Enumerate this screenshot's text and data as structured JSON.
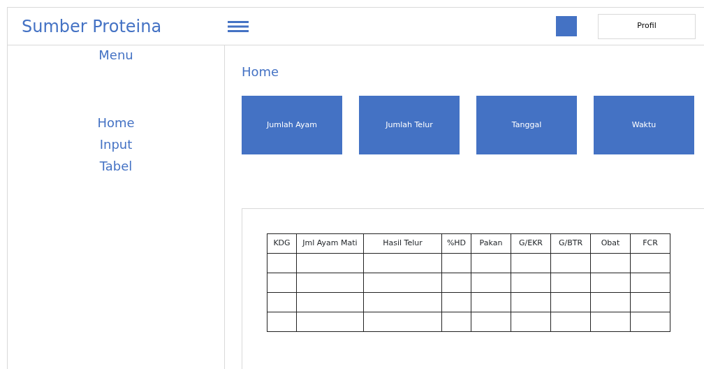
{
  "header": {
    "title": "Sumber Proteina",
    "profile_button": "Profil"
  },
  "sidebar": {
    "heading": "Menu",
    "items": [
      {
        "label": "Home"
      },
      {
        "label": "Input"
      },
      {
        "label": "Tabel"
      }
    ]
  },
  "main": {
    "title": "Home",
    "tiles": [
      {
        "label": "Jumlah Ayam"
      },
      {
        "label": "Jumlah Telur"
      },
      {
        "label": "Tanggal"
      },
      {
        "label": "Waktu"
      }
    ],
    "table": {
      "columns": [
        "KDG",
        "Jml Ayam Mati",
        "Hasil Telur",
        "%HD",
        "Pakan",
        "G/EKR",
        "G/BTR",
        "Obat",
        "FCR"
      ]
    }
  }
}
